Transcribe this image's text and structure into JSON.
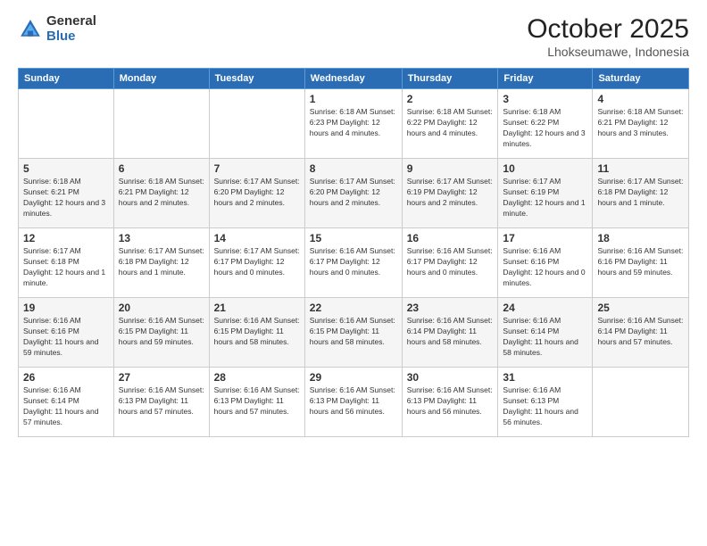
{
  "header": {
    "logo_general": "General",
    "logo_blue": "Blue",
    "month": "October 2025",
    "location": "Lhokseumawe, Indonesia"
  },
  "days_of_week": [
    "Sunday",
    "Monday",
    "Tuesday",
    "Wednesday",
    "Thursday",
    "Friday",
    "Saturday"
  ],
  "weeks": [
    [
      {
        "day": "",
        "info": ""
      },
      {
        "day": "",
        "info": ""
      },
      {
        "day": "",
        "info": ""
      },
      {
        "day": "1",
        "info": "Sunrise: 6:18 AM\nSunset: 6:23 PM\nDaylight: 12 hours and 4 minutes."
      },
      {
        "day": "2",
        "info": "Sunrise: 6:18 AM\nSunset: 6:22 PM\nDaylight: 12 hours and 4 minutes."
      },
      {
        "day": "3",
        "info": "Sunrise: 6:18 AM\nSunset: 6:22 PM\nDaylight: 12 hours and 3 minutes."
      },
      {
        "day": "4",
        "info": "Sunrise: 6:18 AM\nSunset: 6:21 PM\nDaylight: 12 hours and 3 minutes."
      }
    ],
    [
      {
        "day": "5",
        "info": "Sunrise: 6:18 AM\nSunset: 6:21 PM\nDaylight: 12 hours and 3 minutes."
      },
      {
        "day": "6",
        "info": "Sunrise: 6:18 AM\nSunset: 6:21 PM\nDaylight: 12 hours and 2 minutes."
      },
      {
        "day": "7",
        "info": "Sunrise: 6:17 AM\nSunset: 6:20 PM\nDaylight: 12 hours and 2 minutes."
      },
      {
        "day": "8",
        "info": "Sunrise: 6:17 AM\nSunset: 6:20 PM\nDaylight: 12 hours and 2 minutes."
      },
      {
        "day": "9",
        "info": "Sunrise: 6:17 AM\nSunset: 6:19 PM\nDaylight: 12 hours and 2 minutes."
      },
      {
        "day": "10",
        "info": "Sunrise: 6:17 AM\nSunset: 6:19 PM\nDaylight: 12 hours and 1 minute."
      },
      {
        "day": "11",
        "info": "Sunrise: 6:17 AM\nSunset: 6:18 PM\nDaylight: 12 hours and 1 minute."
      }
    ],
    [
      {
        "day": "12",
        "info": "Sunrise: 6:17 AM\nSunset: 6:18 PM\nDaylight: 12 hours and 1 minute."
      },
      {
        "day": "13",
        "info": "Sunrise: 6:17 AM\nSunset: 6:18 PM\nDaylight: 12 hours and 1 minute."
      },
      {
        "day": "14",
        "info": "Sunrise: 6:17 AM\nSunset: 6:17 PM\nDaylight: 12 hours and 0 minutes."
      },
      {
        "day": "15",
        "info": "Sunrise: 6:16 AM\nSunset: 6:17 PM\nDaylight: 12 hours and 0 minutes."
      },
      {
        "day": "16",
        "info": "Sunrise: 6:16 AM\nSunset: 6:17 PM\nDaylight: 12 hours and 0 minutes."
      },
      {
        "day": "17",
        "info": "Sunrise: 6:16 AM\nSunset: 6:16 PM\nDaylight: 12 hours and 0 minutes."
      },
      {
        "day": "18",
        "info": "Sunrise: 6:16 AM\nSunset: 6:16 PM\nDaylight: 11 hours and 59 minutes."
      }
    ],
    [
      {
        "day": "19",
        "info": "Sunrise: 6:16 AM\nSunset: 6:16 PM\nDaylight: 11 hours and 59 minutes."
      },
      {
        "day": "20",
        "info": "Sunrise: 6:16 AM\nSunset: 6:15 PM\nDaylight: 11 hours and 59 minutes."
      },
      {
        "day": "21",
        "info": "Sunrise: 6:16 AM\nSunset: 6:15 PM\nDaylight: 11 hours and 58 minutes."
      },
      {
        "day": "22",
        "info": "Sunrise: 6:16 AM\nSunset: 6:15 PM\nDaylight: 11 hours and 58 minutes."
      },
      {
        "day": "23",
        "info": "Sunrise: 6:16 AM\nSunset: 6:14 PM\nDaylight: 11 hours and 58 minutes."
      },
      {
        "day": "24",
        "info": "Sunrise: 6:16 AM\nSunset: 6:14 PM\nDaylight: 11 hours and 58 minutes."
      },
      {
        "day": "25",
        "info": "Sunrise: 6:16 AM\nSunset: 6:14 PM\nDaylight: 11 hours and 57 minutes."
      }
    ],
    [
      {
        "day": "26",
        "info": "Sunrise: 6:16 AM\nSunset: 6:14 PM\nDaylight: 11 hours and 57 minutes."
      },
      {
        "day": "27",
        "info": "Sunrise: 6:16 AM\nSunset: 6:13 PM\nDaylight: 11 hours and 57 minutes."
      },
      {
        "day": "28",
        "info": "Sunrise: 6:16 AM\nSunset: 6:13 PM\nDaylight: 11 hours and 57 minutes."
      },
      {
        "day": "29",
        "info": "Sunrise: 6:16 AM\nSunset: 6:13 PM\nDaylight: 11 hours and 56 minutes."
      },
      {
        "day": "30",
        "info": "Sunrise: 6:16 AM\nSunset: 6:13 PM\nDaylight: 11 hours and 56 minutes."
      },
      {
        "day": "31",
        "info": "Sunrise: 6:16 AM\nSunset: 6:13 PM\nDaylight: 11 hours and 56 minutes."
      },
      {
        "day": "",
        "info": ""
      }
    ]
  ]
}
